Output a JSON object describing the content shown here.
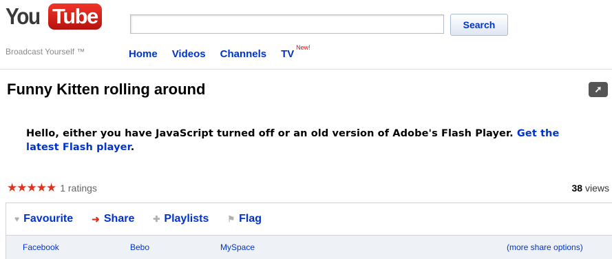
{
  "header": {
    "logo_you": "You",
    "logo_tube": "Tube",
    "tagline": "Broadcast Yourself ™",
    "search": {
      "value": "",
      "button_label": "Search"
    },
    "nav": [
      {
        "label": "Home"
      },
      {
        "label": "Videos"
      },
      {
        "label": "Channels"
      },
      {
        "label": "TV",
        "badge": "New!"
      }
    ]
  },
  "video": {
    "title": "Funny Kitten rolling around",
    "popout_icon": "popout-arrow-icon",
    "flash_message": "Hello, either you have JavaScript turned off or an old version of Adobe's Flash Player.",
    "flash_link": "Get the latest Flash player",
    "flash_suffix": "."
  },
  "stats": {
    "stars_glyph": "★★★★★",
    "stars": 5,
    "ratings_text": "1 ratings",
    "views_count": "38",
    "views_label": "views"
  },
  "actions": [
    {
      "label": "Favourite",
      "icon": "heart-icon"
    },
    {
      "label": "Share",
      "icon": "arrow-right-icon"
    },
    {
      "label": "Playlists",
      "icon": "plus-icon"
    },
    {
      "label": "Flag",
      "icon": "flag-icon"
    }
  ],
  "share": {
    "links": [
      "Facebook",
      "Bebo",
      "MySpace"
    ],
    "more": "(more share options)"
  },
  "colors": {
    "link": "#0033cc",
    "accent_red": "#e0331d",
    "share_bg": "#eef2f7"
  }
}
